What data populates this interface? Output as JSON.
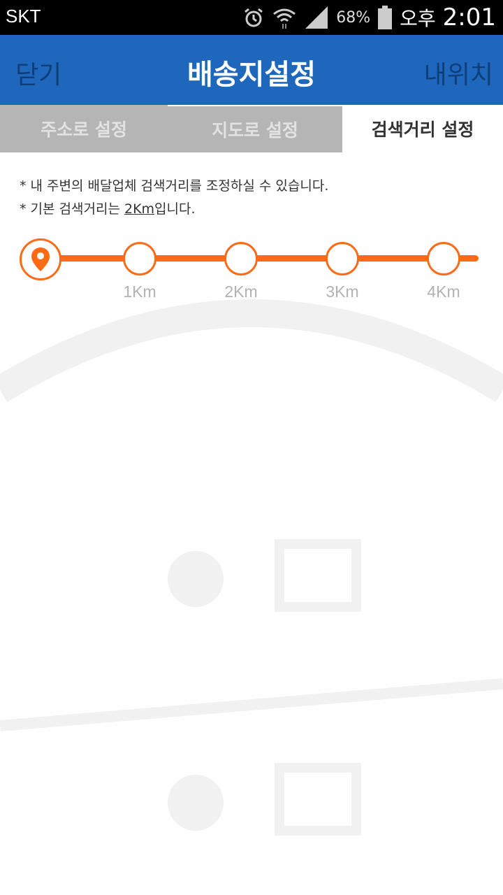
{
  "status_bar": {
    "carrier": "SKT",
    "battery_pct": "68%",
    "ampm": "오후",
    "time": "2:01",
    "icons": [
      "alarm-icon",
      "wifi-icon",
      "signal-icon",
      "battery-icon"
    ]
  },
  "header": {
    "close_label": "닫기",
    "title": "배송지설정",
    "myloc_label": "내위치",
    "color": "#1e67bd"
  },
  "tabs": [
    {
      "label": "주소로 설정",
      "active": false
    },
    {
      "label": "지도로 설정",
      "active": false
    },
    {
      "label": "검색거리 설정",
      "active": true
    }
  ],
  "info": {
    "line1": "* 내 주변의 배달업체 검색거리를 조정하실 수 있습니다.",
    "line2_prefix": "* 기본 검색거리는 ",
    "line2_value": "2Km",
    "line2_suffix": "입니다."
  },
  "slider": {
    "accent": "#ff6a14",
    "stops": [
      "1Km",
      "2Km",
      "3Km",
      "4Km"
    ],
    "selected_index": 0,
    "handle_icon": "location-pin-icon"
  }
}
